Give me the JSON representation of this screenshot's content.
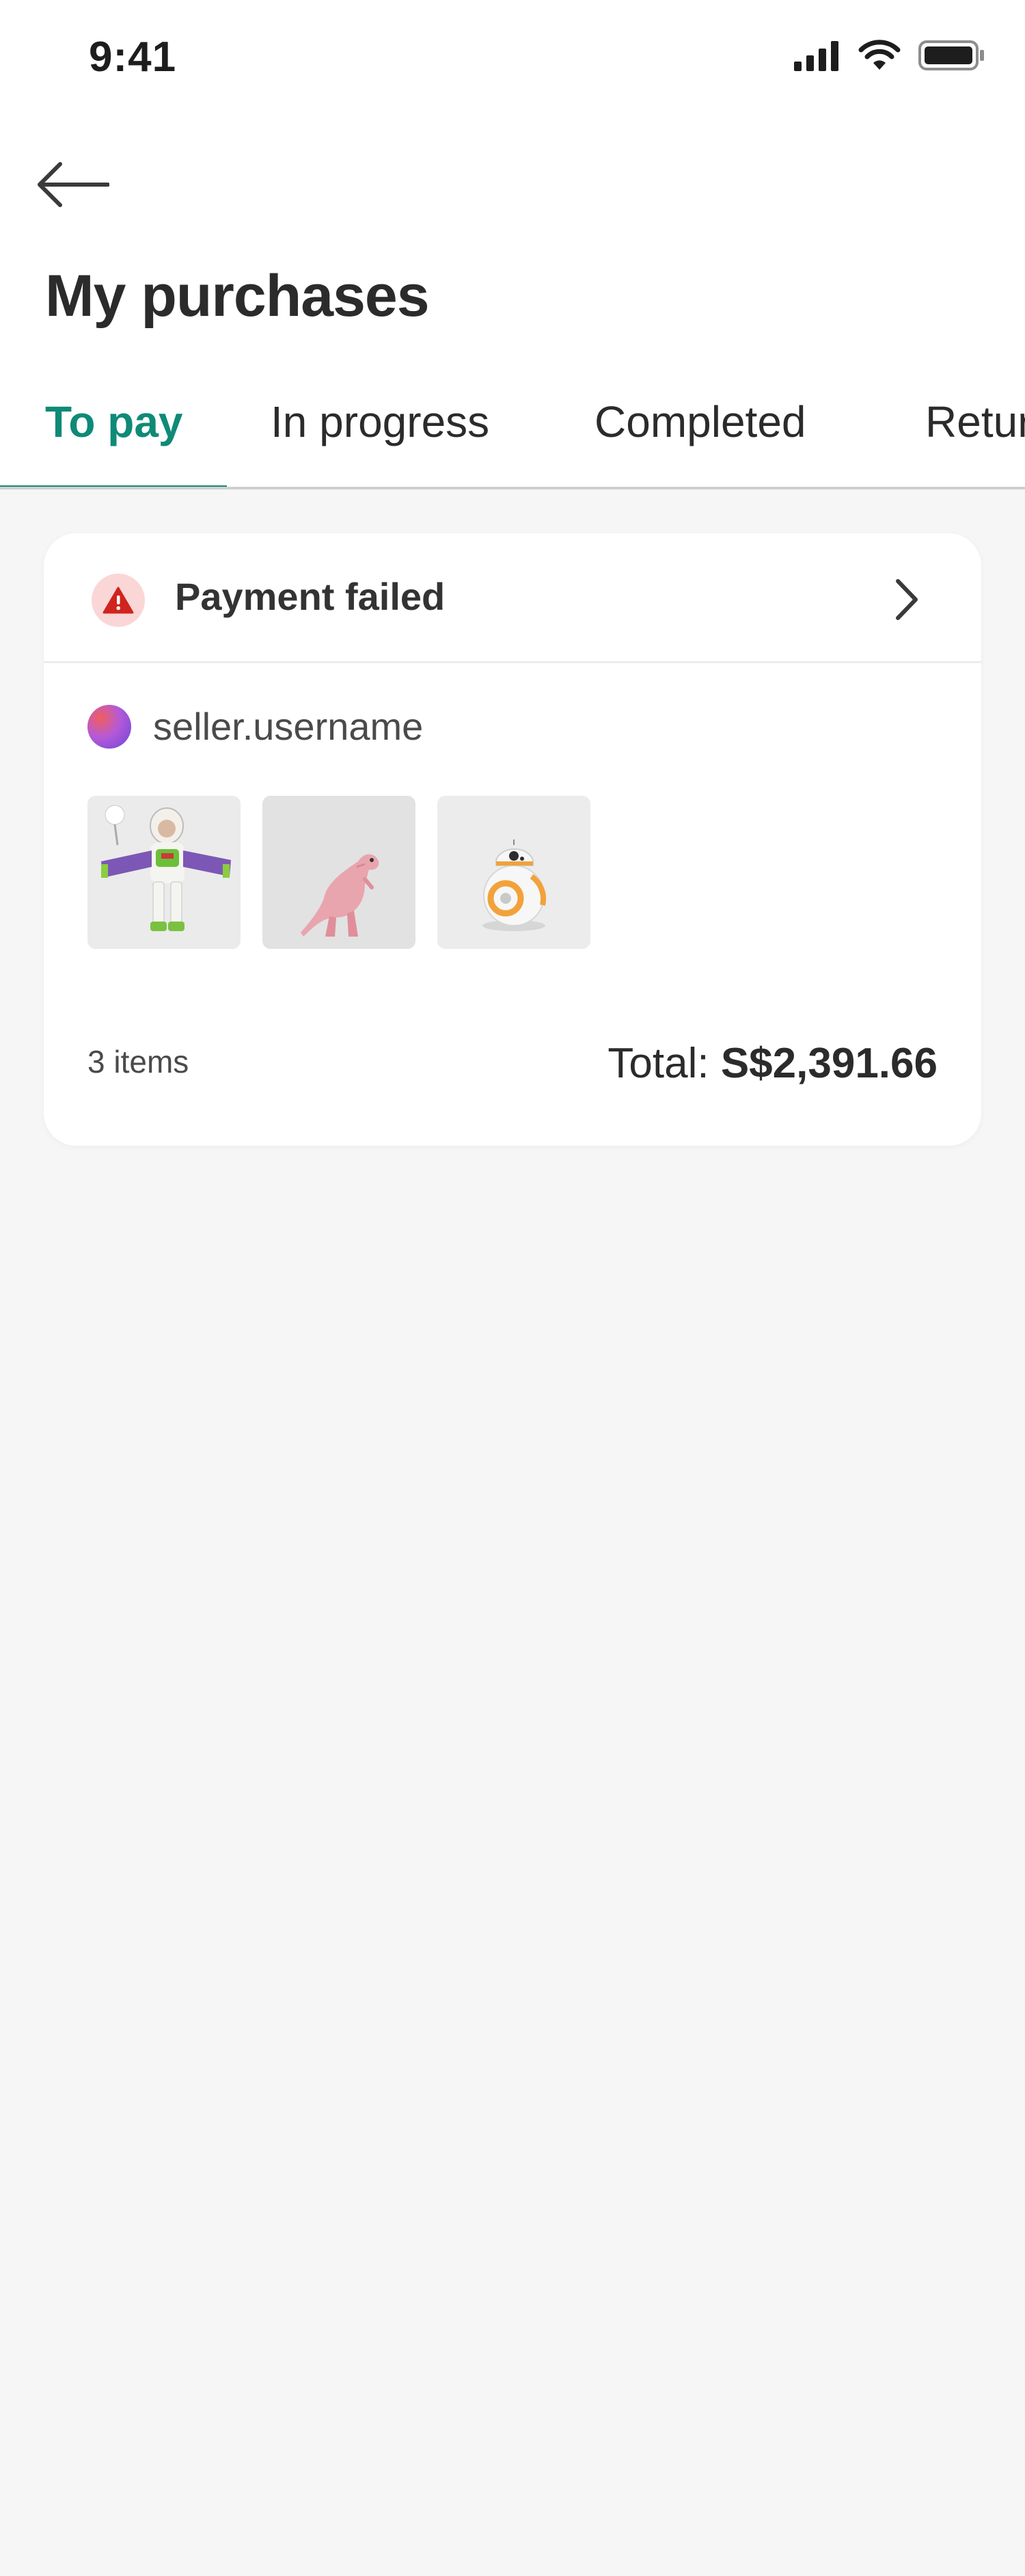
{
  "status_bar": {
    "time": "9:41"
  },
  "header": {
    "title": "My purchases"
  },
  "tabs": [
    {
      "label": "To pay",
      "active": true
    },
    {
      "label": "In progress",
      "active": false
    },
    {
      "label": "Completed",
      "active": false
    },
    {
      "label": "Returns",
      "active": false
    }
  ],
  "order": {
    "status_label": "Payment failed",
    "seller": "seller.username",
    "items": [
      {
        "name": "Buzz Lightyear toy"
      },
      {
        "name": "Pink dinosaur toy"
      },
      {
        "name": "BB-8 droid toy"
      }
    ],
    "items_count": "3 items",
    "total_label": "Total:",
    "total_value": "S$2,391.66"
  },
  "colors": {
    "accent": "#0f8a77",
    "error": "#d0241f",
    "background": "#f6f6f6"
  },
  "icons": {
    "back": "arrow-left-icon",
    "alert": "warning-triangle-icon",
    "chevron": "chevron-right-icon",
    "signal": "signal-icon",
    "wifi": "wifi-icon",
    "battery": "battery-icon"
  }
}
